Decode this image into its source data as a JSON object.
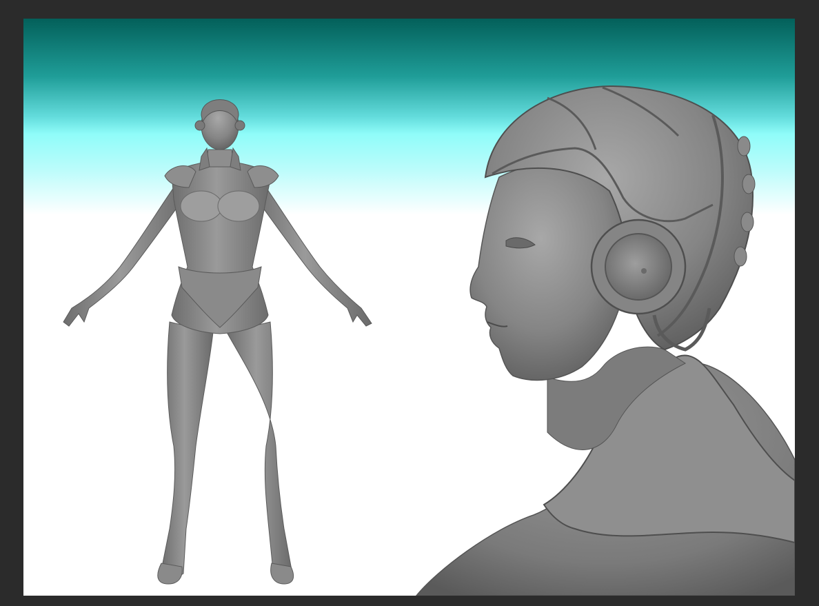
{
  "scene": {
    "frame_color": "#2b2b2b",
    "background_gradient": [
      "#03605a",
      "#8ffcf9",
      "#ffffff"
    ],
    "clay_color": "#8c8c8c",
    "subjects": [
      {
        "name": "full-body-figure",
        "view": "front",
        "pose": "A-pose"
      },
      {
        "name": "head-closeup",
        "view": "profile-right",
        "feature": "headphone-helmet"
      }
    ]
  }
}
